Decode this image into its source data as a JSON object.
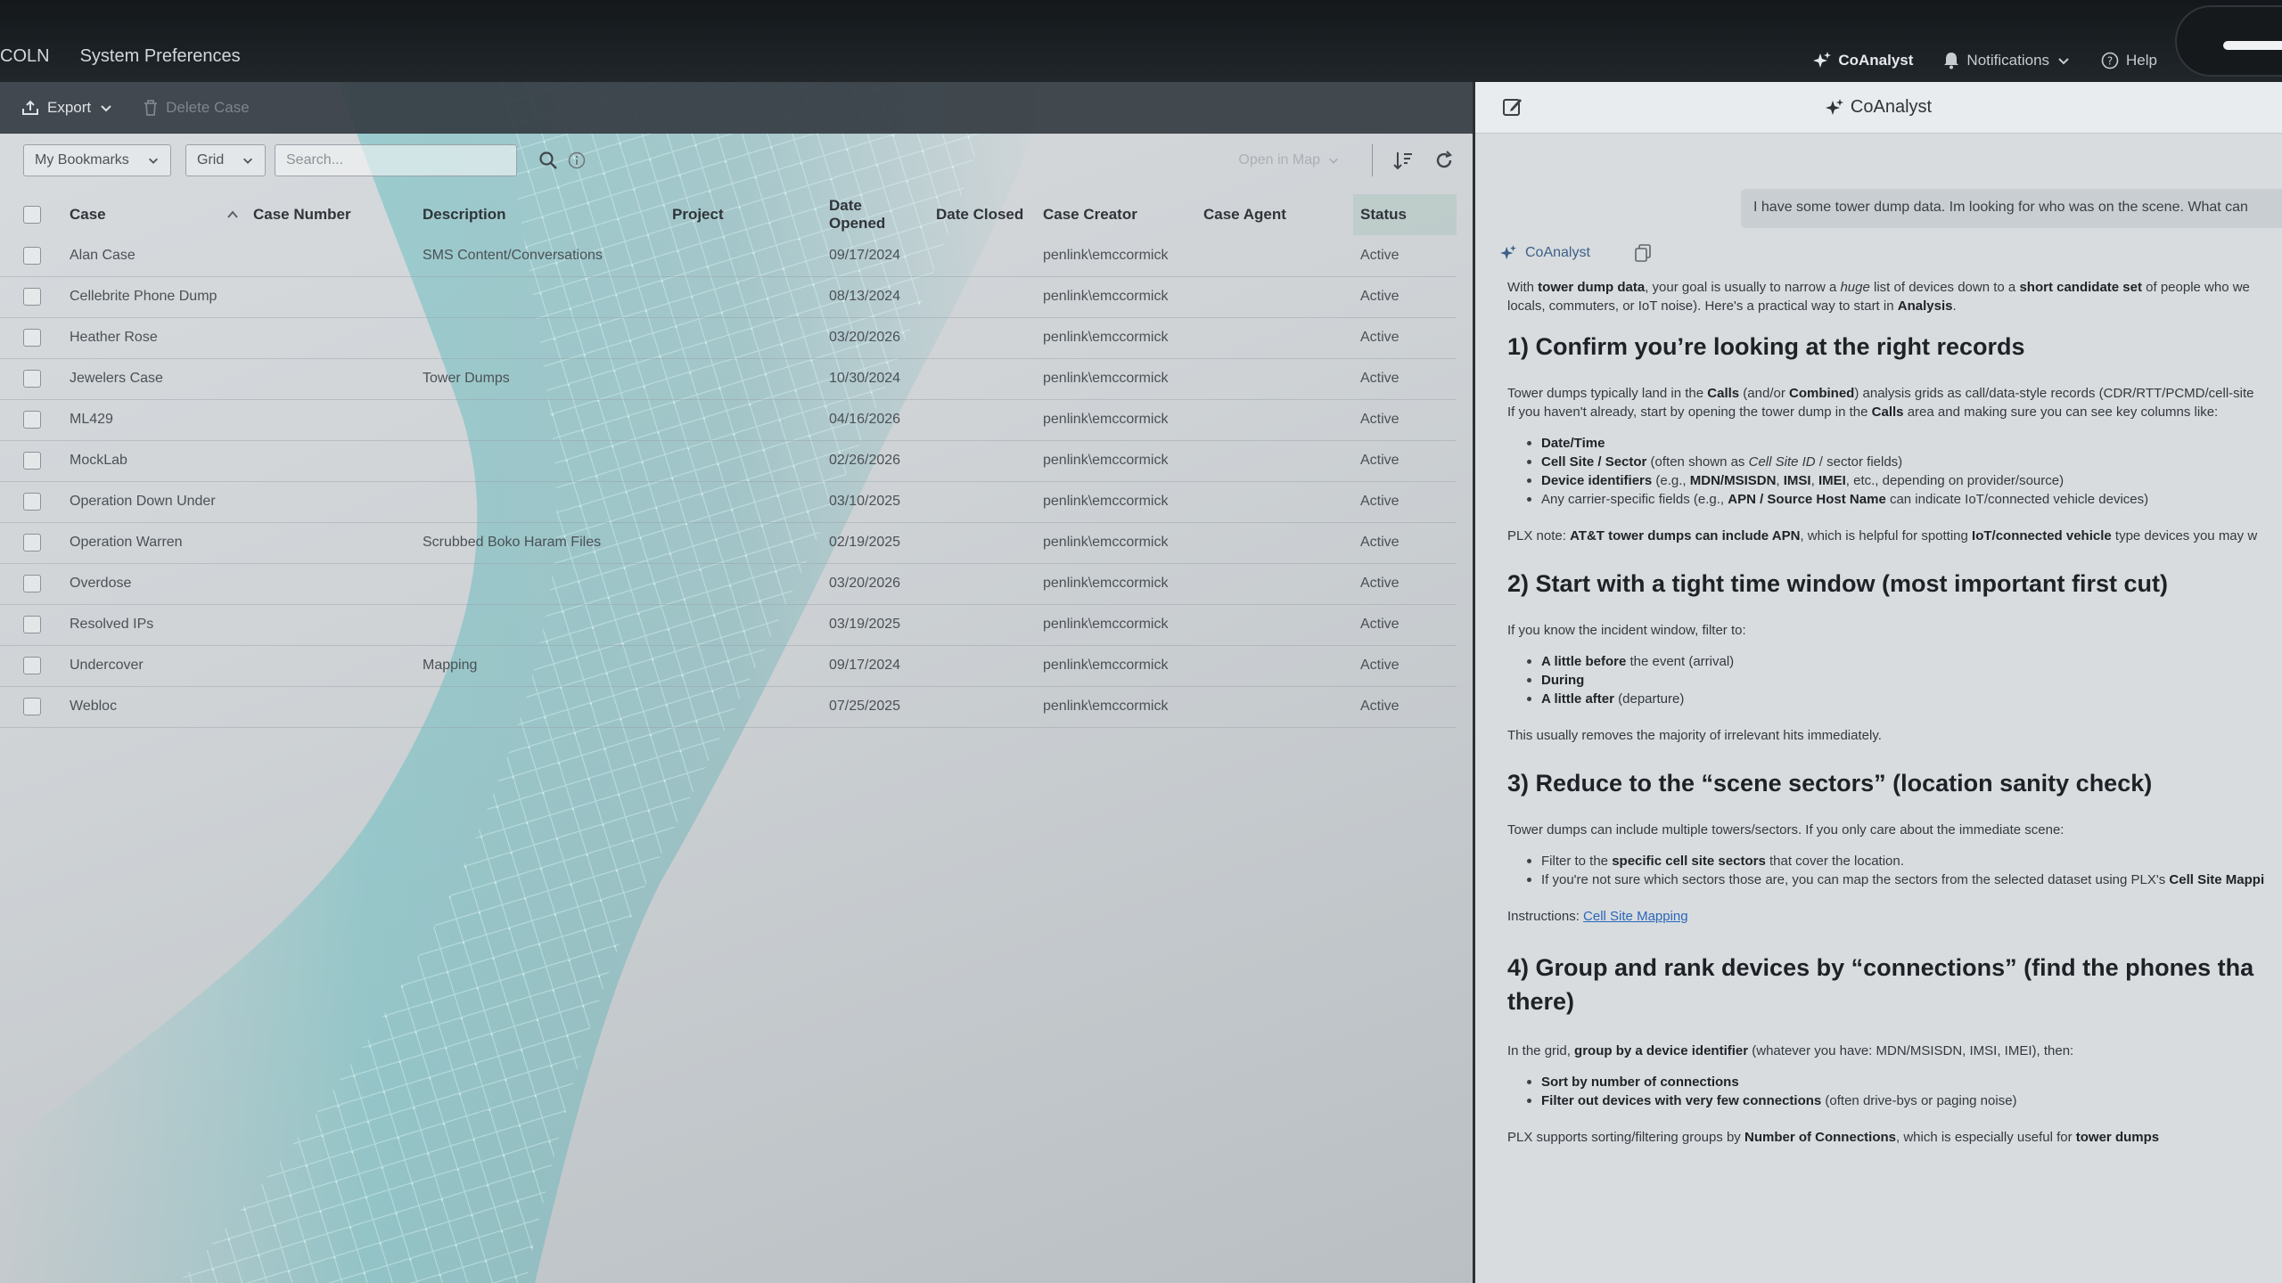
{
  "topbar": {
    "menu": [
      "COLN",
      "System Preferences"
    ],
    "coanalyst": "CoAnalyst",
    "notifications": "Notifications",
    "help": "Help"
  },
  "actions": {
    "export": "Export",
    "delete_case": "Delete Case"
  },
  "filters": {
    "bookmarks": "My Bookmarks",
    "view": "Grid",
    "search_placeholder": "Search...",
    "open_in_map": "Open in Map"
  },
  "table": {
    "headers": [
      "Case",
      "Case Number",
      "Description",
      "Project",
      "Date Opened",
      "Date Closed",
      "Case Creator",
      "Case Agent",
      "Status"
    ],
    "rows": [
      {
        "case": "Alan Case",
        "description": "SMS Content/Conversations",
        "opened": "09/17/2024",
        "creator": "penlink\\emccormick",
        "status": "Active"
      },
      {
        "case": "Cellebrite Phone Dump",
        "description": "",
        "opened": "08/13/2024",
        "creator": "penlink\\emccormick",
        "status": "Active"
      },
      {
        "case": "Heather Rose",
        "description": "",
        "opened": "03/20/2026",
        "creator": "penlink\\emccormick",
        "status": "Active"
      },
      {
        "case": "Jewelers Case",
        "description": "Tower Dumps",
        "opened": "10/30/2024",
        "creator": "penlink\\emccormick",
        "status": "Active"
      },
      {
        "case": "ML429",
        "description": "",
        "opened": "04/16/2026",
        "creator": "penlink\\emccormick",
        "status": "Active"
      },
      {
        "case": "MockLab",
        "description": "",
        "opened": "02/26/2026",
        "creator": "penlink\\emccormick",
        "status": "Active"
      },
      {
        "case": "Operation Down Under",
        "description": "",
        "opened": "03/10/2025",
        "creator": "penlink\\emccormick",
        "status": "Active"
      },
      {
        "case": "Operation Warren",
        "description": "Scrubbed Boko Haram Files",
        "opened": "02/19/2025",
        "creator": "penlink\\emccormick",
        "status": "Active"
      },
      {
        "case": "Overdose",
        "description": "",
        "opened": "03/20/2026",
        "creator": "penlink\\emccormick",
        "status": "Active"
      },
      {
        "case": "Resolved IPs",
        "description": "",
        "opened": "03/19/2025",
        "creator": "penlink\\emccormick",
        "status": "Active"
      },
      {
        "case": "Undercover",
        "description": "Mapping",
        "opened": "09/17/2024",
        "creator": "penlink\\emccormick",
        "status": "Active"
      },
      {
        "case": "Webloc",
        "description": "",
        "opened": "07/25/2025",
        "creator": "penlink\\emccormick",
        "status": "Active"
      }
    ]
  },
  "panel": {
    "title": "CoAnalyst",
    "user_message": "I have some tower dump data. Im looking for who was on the scene. What can",
    "author": "CoAnalyst",
    "intro": {
      "a": "With ",
      "b": "tower dump data",
      "c": ", your goal is usually to narrow a ",
      "d": "huge",
      "e": " list of devices down to a ",
      "f": "short candidate set",
      "g": " of people who we",
      "line2a": "locals, commuters, or IoT noise). Here's a practical way to start in ",
      "line2b": "Analysis",
      "line2c": "."
    },
    "s1": {
      "title": "1) Confirm you’re looking at the right records",
      "p1a": "Tower dumps typically land in the ",
      "p1b": "Calls",
      "p1c": " (and/or ",
      "p1d": "Combined",
      "p1e": ") analysis grids as call/data-style records (CDR/RTT/PCMD/cell-site",
      "p2a": "If you haven't already, start by opening the tower dump in the ",
      "p2b": "Calls",
      "p2c": " area and making sure you can see key columns like:",
      "b1": "Date/Time",
      "b2a": "Cell Site / Sector",
      "b2b": " (often shown as ",
      "b2c": "Cell Site ID",
      "b2d": " / sector fields)",
      "b3a": "Device identifiers",
      "b3b": " (e.g., ",
      "b3c": "MDN/MSISDN",
      "b3d": ", ",
      "b3e": "IMSI",
      "b3f": ", ",
      "b3g": "IMEI",
      "b3h": ", etc., depending on provider/source)",
      "b4a": "Any carrier-specific fields (e.g., ",
      "b4b": "APN / Source Host Name",
      "b4c": " can indicate IoT/connected vehicle devices)",
      "notea": "PLX note: ",
      "noteb": "AT&T tower dumps can include APN",
      "notec": ", which is helpful for spotting ",
      "noted": "IoT/connected vehicle",
      "notee": " type devices you may w"
    },
    "s2": {
      "title": "2) Start with a tight time window (most important first cut)",
      "p": "If you know the incident window, filter to:",
      "b1a": "A little before",
      "b1b": " the event (arrival)",
      "b2": "During",
      "b3a": "A little after",
      "b3b": " (departure)",
      "p2": "This usually removes the majority of irrelevant hits immediately."
    },
    "s3": {
      "title": "3) Reduce to the “scene sectors” (location sanity check)",
      "p": "Tower dumps can include multiple towers/sectors. If you only care about the immediate scene:",
      "b1a": "Filter to the ",
      "b1b": "specific cell site sectors",
      "b1c": " that cover the location.",
      "b2a": "If you're not sure which sectors those are, you can map the sectors from the selected dataset using PLX's ",
      "b2b": "Cell Site Mappi",
      "instr": "Instructions: ",
      "link": "Cell Site Mapping"
    },
    "s4": {
      "title": "4) Group and rank devices by “connections” (find the phones tha there)",
      "pa": "In the grid, ",
      "pb": "group by a device identifier",
      "pc": " (whatever you have: MDN/MSISDN, IMSI, IMEI), then:",
      "b1": "Sort by number of connections",
      "b2a": "Filter out devices with very few connections",
      "b2b": " (often drive-bys or paging noise)",
      "p2a": "PLX supports sorting/filtering groups by ",
      "p2b": "Number of Connections",
      "p2c": ", which is especially useful for ",
      "p2d": "tower dumps"
    }
  },
  "colors": {
    "accent": "#2c66b8",
    "status_header": "#b4c8c3",
    "topbar": "#14181b"
  }
}
